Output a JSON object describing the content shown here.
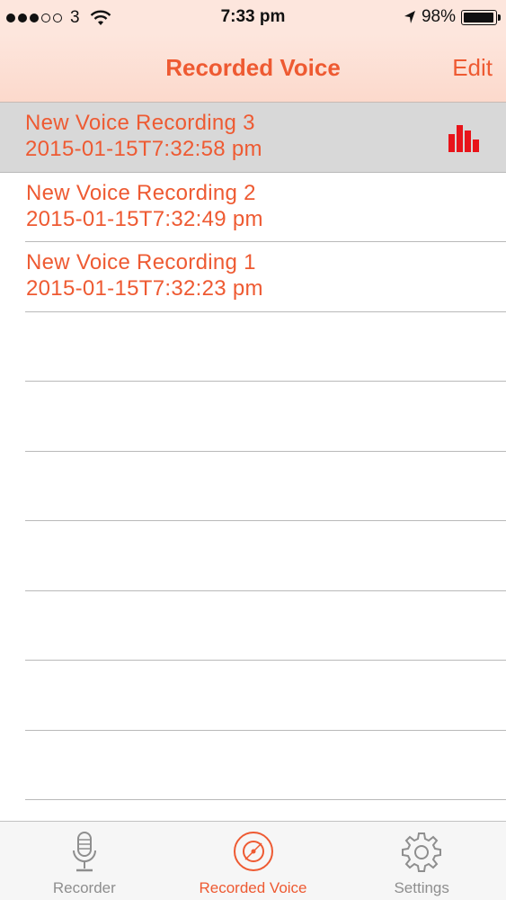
{
  "status": {
    "carrier": "3",
    "time": "7:33 pm",
    "battery": "98%",
    "battery_level": 0.98,
    "signal_bars_filled": 3,
    "signal_bars_total": 5
  },
  "nav": {
    "title": "Recorded Voice",
    "edit_label": "Edit"
  },
  "recordings": [
    {
      "title": "New Voice Recording 3",
      "date": "2015-01-15T7:32:58 pm",
      "selected": true,
      "playing_icon": "equalizer-icon"
    },
    {
      "title": "New Voice Recording 2",
      "date": "2015-01-15T7:32:49 pm",
      "selected": false
    },
    {
      "title": "New Voice Recording 1",
      "date": "2015-01-15T7:32:23 pm",
      "selected": false
    }
  ],
  "tabs": [
    {
      "label": "Recorder",
      "icon": "microphone-icon",
      "active": false
    },
    {
      "label": "Recorded Voice",
      "icon": "disc-icon",
      "active": true
    },
    {
      "label": "Settings",
      "icon": "gear-icon",
      "active": false
    }
  ],
  "colors": {
    "accent": "#ee5a32",
    "equalizer": "#e8141a",
    "nav_background": "#fde6dd",
    "selected_row": "#d8d8d8"
  }
}
